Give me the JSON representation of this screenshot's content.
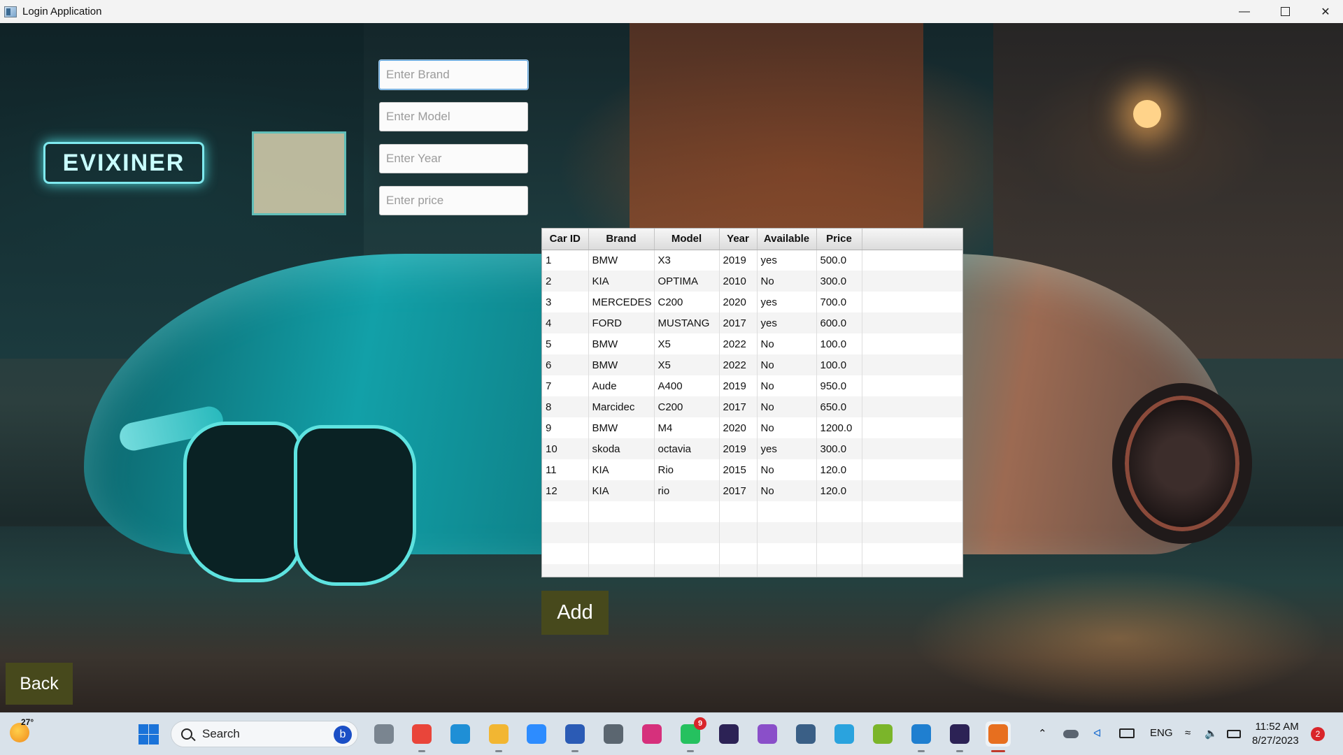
{
  "window": {
    "title": "Login Application"
  },
  "form": {
    "brand_placeholder": "Enter Brand",
    "model_placeholder": "Enter Model",
    "year_placeholder": "Enter Year",
    "price_placeholder": "Enter price"
  },
  "table": {
    "headers": [
      "Car ID",
      "Brand",
      "Model",
      "Year",
      "Available",
      "Price"
    ],
    "rows": [
      [
        "1",
        "BMW",
        "X3",
        "2019",
        "yes",
        "500.0"
      ],
      [
        "2",
        "KIA",
        "OPTIMA",
        "2010",
        "No",
        "300.0"
      ],
      [
        "3",
        "MERCEDES",
        "C200",
        "2020",
        "yes",
        "700.0"
      ],
      [
        "4",
        "FORD",
        "MUSTANG",
        "2017",
        "yes",
        "600.0"
      ],
      [
        "5",
        "BMW",
        "X5",
        "2022",
        "No",
        "100.0"
      ],
      [
        "6",
        "BMW",
        "X5",
        "2022",
        "No",
        "100.0"
      ],
      [
        "7",
        "Aude",
        "A400",
        "2019",
        "No",
        "950.0"
      ],
      [
        "8",
        "Marcidec",
        "C200",
        "2017",
        "No",
        "650.0"
      ],
      [
        "9",
        "BMW",
        "M4",
        "2020",
        "No",
        "1200.0"
      ],
      [
        "10",
        "skoda",
        "octavia",
        "2019",
        "yes",
        "300.0"
      ],
      [
        "11",
        "KIA",
        "Rio",
        "2015",
        "No",
        "120.0"
      ],
      [
        "12",
        "KIA",
        "rio",
        "2017",
        "No",
        "120.0"
      ]
    ],
    "empty_rows": 4
  },
  "buttons": {
    "add_label": "Add",
    "back_label": "Back"
  },
  "background": {
    "sign_text": "EVIXINER"
  },
  "taskbar": {
    "weather_temp": "27°",
    "search_label": "Search",
    "whatsapp_badge": "9",
    "lang": "ENG",
    "time": "11:52 AM",
    "date": "8/27/2023",
    "notification_count": "2",
    "apps": [
      {
        "name": "task-view-icon",
        "color": "#7a8590"
      },
      {
        "name": "chrome-icon",
        "color": "#e9453a"
      },
      {
        "name": "edge-icon",
        "color": "#1f8fd6"
      },
      {
        "name": "file-explorer-icon",
        "color": "#f2b632"
      },
      {
        "name": "zoom-icon",
        "color": "#2d8cff"
      },
      {
        "name": "word-icon",
        "color": "#2b5bb5"
      },
      {
        "name": "settings-icon",
        "color": "#5b6670"
      },
      {
        "name": "instagram-icon",
        "color": "#d6307c"
      },
      {
        "name": "whatsapp-icon",
        "color": "#25c15f"
      },
      {
        "name": "eclipse-icon",
        "color": "#2c2255"
      },
      {
        "name": "feather-icon",
        "color": "#8a4fc9"
      },
      {
        "name": "mysql-workbench-icon",
        "color": "#3a5f86"
      },
      {
        "name": "telegram-icon",
        "color": "#2aa3de"
      },
      {
        "name": "lambda-app-icon",
        "color": "#7bb52a"
      },
      {
        "name": "vscode-icon",
        "color": "#1f7fd0"
      },
      {
        "name": "eclipse-2-icon",
        "color": "#2c2255"
      },
      {
        "name": "java-icon",
        "color": "#e76f1f"
      }
    ]
  }
}
